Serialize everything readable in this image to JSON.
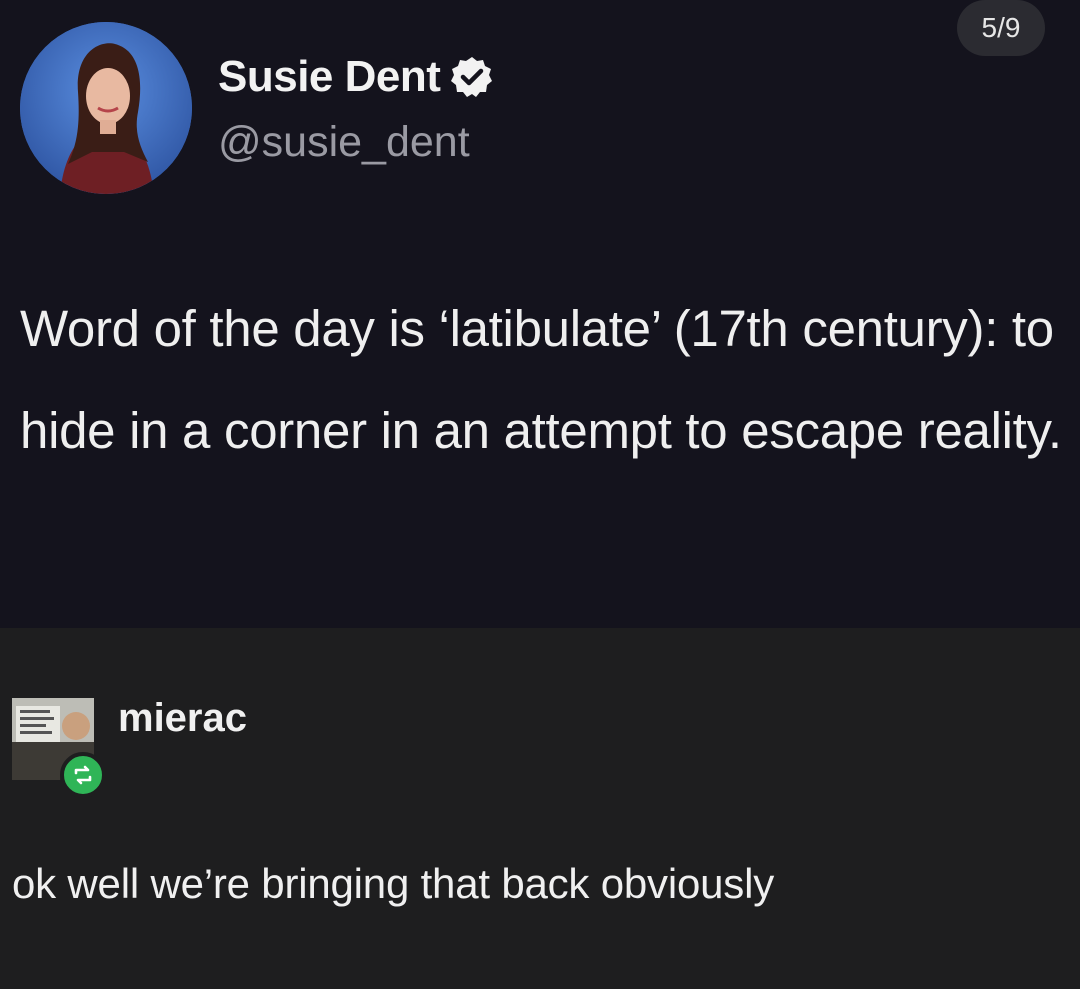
{
  "tweet": {
    "display_name": "Susie Dent",
    "handle": "@susie_dent",
    "page_indicator": "5/9",
    "text": "Word of the day is ‘latibulate’ (17th century): to hide in a corner in an attempt to escape reality.",
    "verified_icon": "verified-check-icon"
  },
  "reply": {
    "username": "mierac",
    "text": "ok well we’re bringing that back obviously",
    "badge_icon": "reblog-icon"
  },
  "colors": {
    "tweet_background": "#14131d",
    "reply_background": "#1e1e1f",
    "reblog_badge": "#2fb557"
  }
}
